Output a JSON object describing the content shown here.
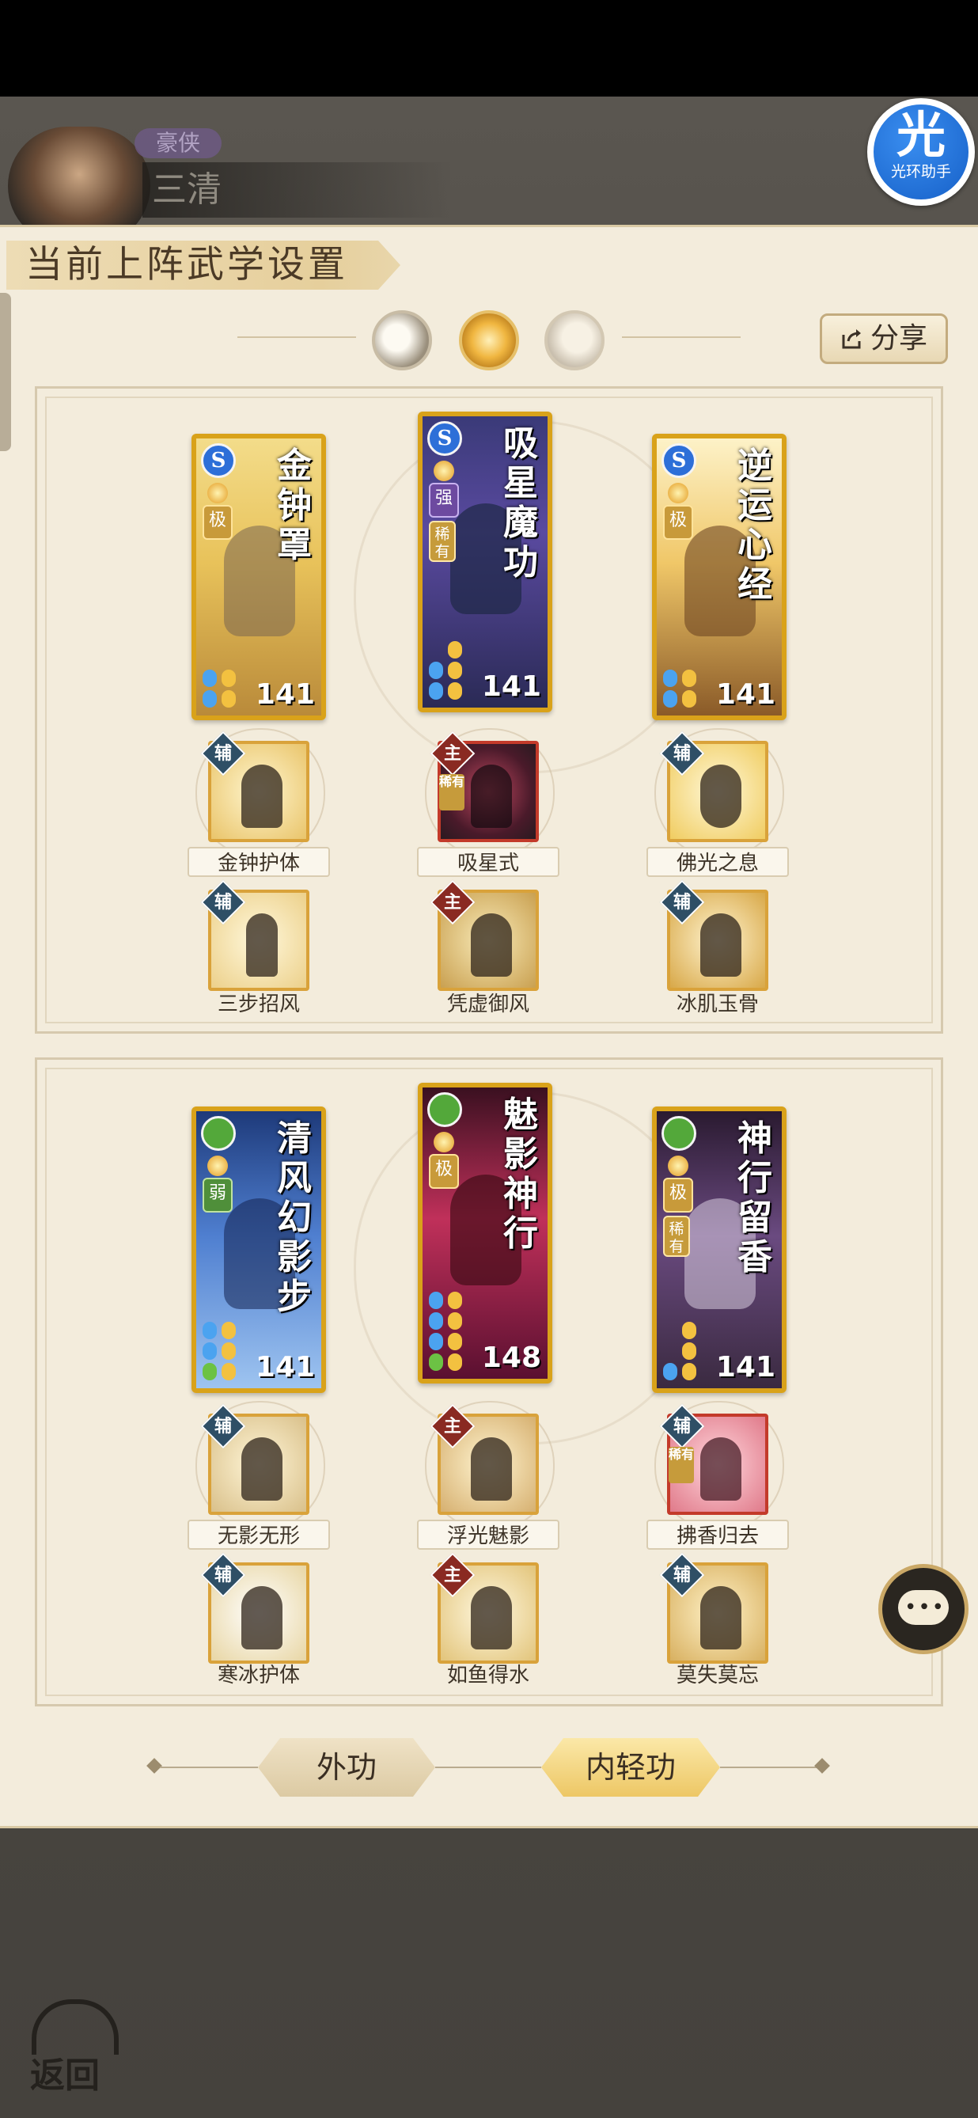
{
  "header": {
    "rank_badge": "豪侠",
    "player_name": "三清",
    "helper": {
      "glyph": "光",
      "label": "光环助手"
    }
  },
  "panel": {
    "title": "当前上阵武学设置",
    "share_label": "分享",
    "phase_icons": [
      "crescent-moon-icon",
      "sun-icon",
      "full-moon-icon"
    ]
  },
  "inner_martial": {
    "cards": [
      {
        "name": "金钟罩",
        "type_icon": "S",
        "tier": "极",
        "level": "141"
      },
      {
        "name": "吸星魔功",
        "type_icon": "S",
        "tier": "强",
        "rare": "稀有",
        "level": "141"
      },
      {
        "name": "逆运心经",
        "type_icon": "S",
        "tier": "极",
        "level": "141"
      }
    ],
    "skills_row1": [
      {
        "role": "辅",
        "label": "金钟护体"
      },
      {
        "role": "主",
        "label": "吸星式",
        "rare": "稀有"
      },
      {
        "role": "辅",
        "label": "佛光之息"
      }
    ],
    "skills_row2": [
      {
        "role": "辅",
        "label": "三步招风"
      },
      {
        "role": "主",
        "label": "凭虚御风"
      },
      {
        "role": "辅",
        "label": "冰肌玉骨"
      }
    ]
  },
  "qinggong": {
    "cards": [
      {
        "name": "清风幻影步",
        "type_icon": "",
        "tier": "弱",
        "level": "141"
      },
      {
        "name": "魅影神行",
        "type_icon": "",
        "tier": "极",
        "level": "148"
      },
      {
        "name": "神行留香",
        "type_icon": "",
        "tier": "极",
        "rare": "稀有",
        "level": "141"
      }
    ],
    "skills_row1": [
      {
        "role": "辅",
        "label": "无影无形"
      },
      {
        "role": "主",
        "label": "浮光魅影"
      },
      {
        "role": "辅",
        "label": "拂香归去",
        "rare": "稀有"
      }
    ],
    "skills_row2": [
      {
        "role": "辅",
        "label": "寒冰护体"
      },
      {
        "role": "主",
        "label": "如鱼得水"
      },
      {
        "role": "辅",
        "label": "莫失莫忘"
      }
    ]
  },
  "tabs": {
    "outer": "外功",
    "inner_qing": "内轻功"
  },
  "footer": {
    "back_label": "返回"
  },
  "colors": {
    "gold_frame": "#d9a21a",
    "panel_bg": "#f3ecdc",
    "aux_badge": "#2f4f66",
    "main_badge": "#8a2a22"
  }
}
